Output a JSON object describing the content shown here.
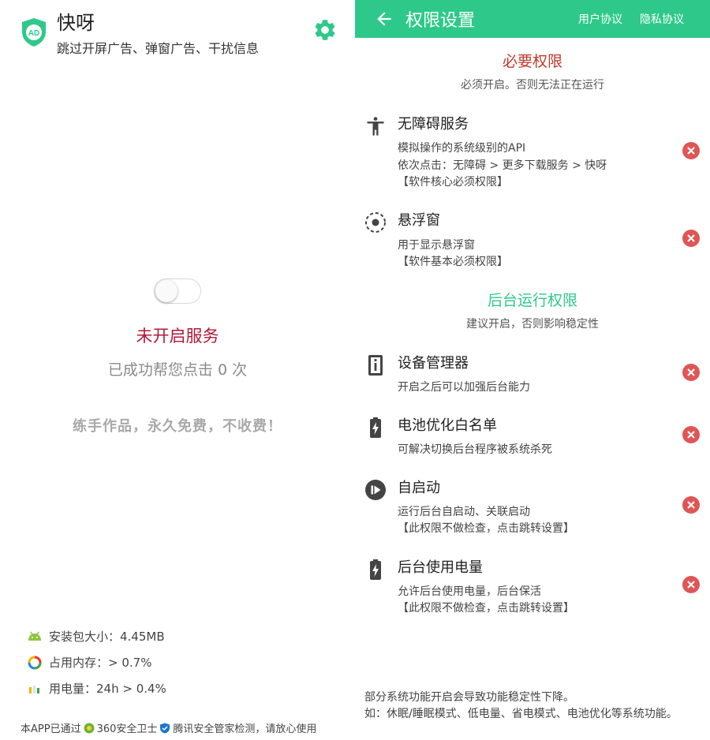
{
  "left": {
    "app_name": "快呀",
    "app_desc": "跳过开屏广告、弹窗广告、干扰信息",
    "logo_text": "AD",
    "toggle_on": false,
    "service_status": "未开启服务",
    "click_count": "已成功帮您点击 0 次",
    "slogan": "练手作品，永久免费，不收费！",
    "stats": [
      {
        "icon": "android-icon",
        "text": "安装包大小：4.45MB"
      },
      {
        "icon": "memory-ring-icon",
        "text": "占用内存：> 0.7%"
      },
      {
        "icon": "battery-bars-icon",
        "text": "用电量：24h > 0.4%"
      }
    ],
    "footer": {
      "prefix": "本APP已通过",
      "vendor1": "360安全卫士",
      "vendor2": "腾讯安全管家检测，请放心使用"
    }
  },
  "right": {
    "title": "权限设置",
    "user_agreement": "用户协议",
    "privacy_policy": "隐私协议",
    "required": {
      "title": "必要权限",
      "subtitle": "必须开启。否则无法正在运行",
      "color": "#c0392b"
    },
    "background": {
      "title": "后台运行权限",
      "subtitle": "建议开启，否则影响稳定性",
      "color": "#2ec98a"
    },
    "permissions": [
      {
        "icon": "accessibility-icon",
        "title": "无障碍服务",
        "lines": [
          "模拟操作的系统级别的API",
          "依次点击：无障碍 > 更多下载服务 > 快呀",
          "【软件核心必须权限】"
        ]
      },
      {
        "icon": "floating-window-icon",
        "title": "悬浮窗",
        "lines": [
          "用于显示悬浮窗",
          "【软件基本必须权限】"
        ]
      },
      {
        "icon": "device-admin-icon",
        "title": "设备管理器",
        "lines": [
          "开启之后可以加强后台能力"
        ]
      },
      {
        "icon": "battery-charging-icon",
        "title": "电池优化白名单",
        "lines": [
          "可解决切换后台程序被系统杀死"
        ]
      },
      {
        "icon": "autostart-icon",
        "title": "自启动",
        "lines": [
          "运行后台自启动、关联启动",
          "【此权限不做检查，点击跳转设置】"
        ]
      },
      {
        "icon": "battery-charging-icon",
        "title": "后台使用电量",
        "lines": [
          "允许后台使用电量，后台保活",
          "【此权限不做检查，点击跳转设置】"
        ]
      }
    ],
    "bottom_note": [
      "部分系统功能开启会导致功能稳定性下降。",
      "如：休眠/睡眠模式、低电量、省电模式、电池优化等系统功能。"
    ],
    "status_color": "#e05555"
  }
}
